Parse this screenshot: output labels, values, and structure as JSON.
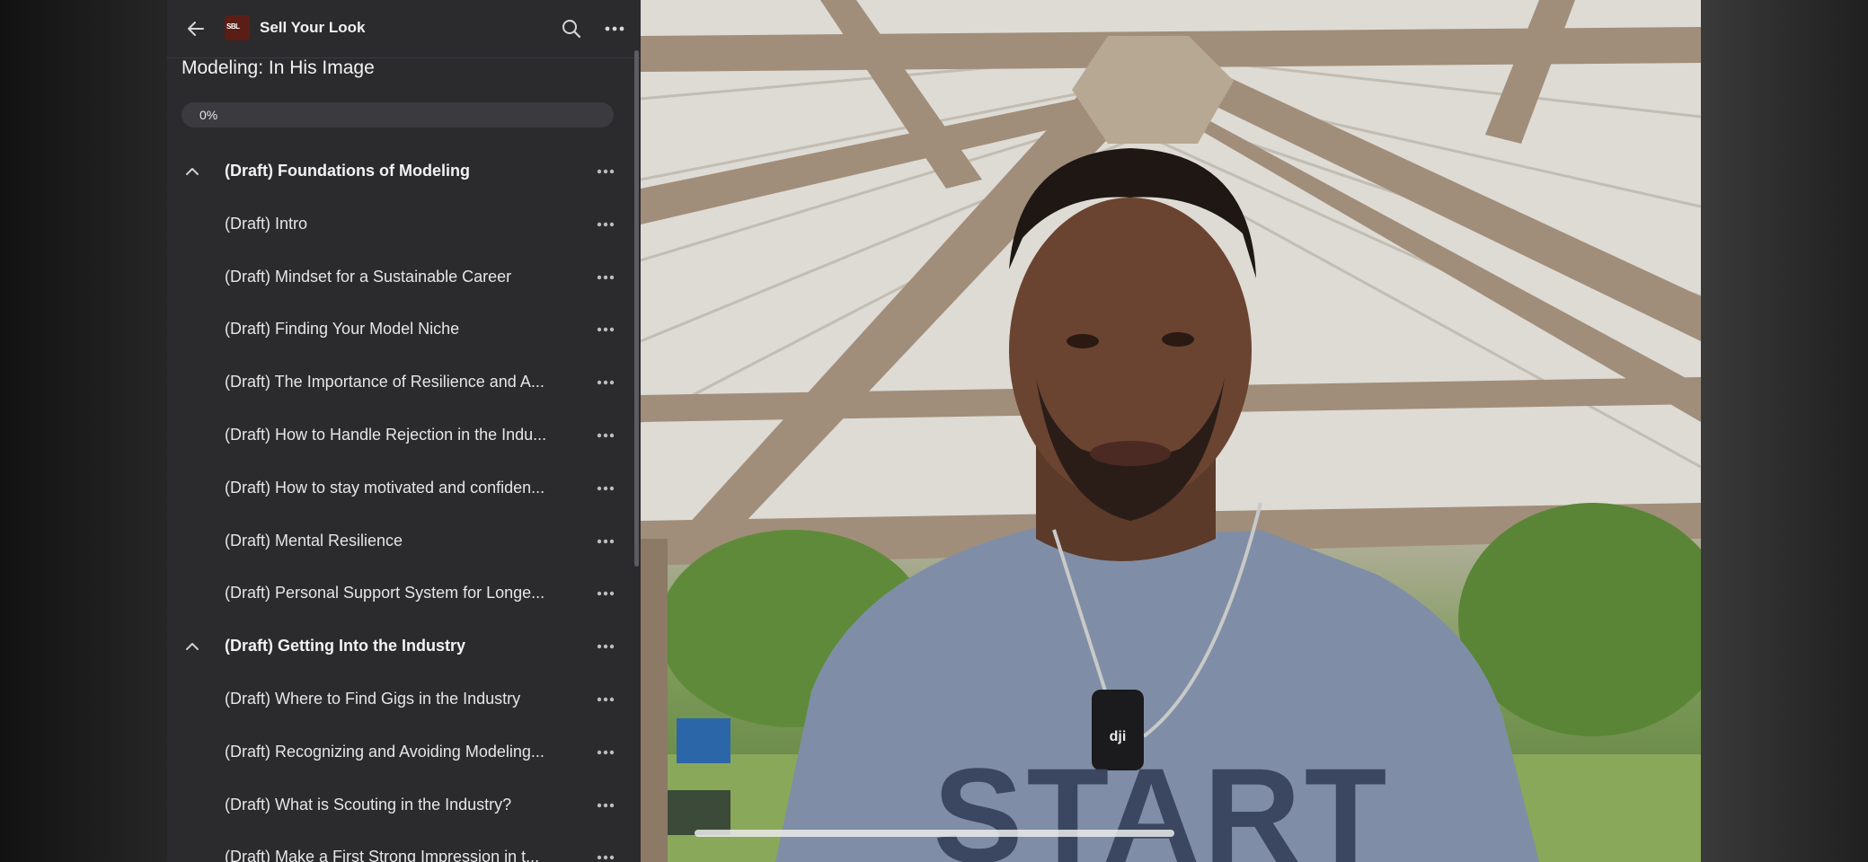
{
  "app": {
    "title": "Sell Your Look",
    "logo_text": "SBL",
    "course_title": "Modeling: In His Image",
    "progress_label": "0%",
    "progress_fraction": 0.0
  },
  "icons": {
    "back": "arrow-left-icon",
    "search": "search-icon",
    "more": "more-horizontal-icon",
    "collapse": "chevron-up-icon"
  },
  "lessons": [
    {
      "label": "(Draft) Foundations of Modeling",
      "type": "section"
    },
    {
      "label": "(Draft) Intro",
      "type": "lesson"
    },
    {
      "label": "(Draft) Mindset for a Sustainable Career",
      "type": "lesson"
    },
    {
      "label": "(Draft) Finding Your Model Niche",
      "type": "lesson"
    },
    {
      "label": "(Draft) The Importance of Resilience and A...",
      "type": "lesson"
    },
    {
      "label": "(Draft) How to Handle Rejection in the Indu...",
      "type": "lesson"
    },
    {
      "label": "(Draft) How to stay motivated and confiden...",
      "type": "lesson"
    },
    {
      "label": "(Draft) Mental Resilience",
      "type": "lesson"
    },
    {
      "label": "(Draft) Personal Support System for Longe...",
      "type": "lesson"
    },
    {
      "label": "(Draft) Getting Into the Industry",
      "type": "section"
    },
    {
      "label": "(Draft) Where to Find Gigs in the Industry",
      "type": "lesson"
    },
    {
      "label": "(Draft) Recognizing and Avoiding Modeling...",
      "type": "lesson"
    },
    {
      "label": "(Draft) What is Scouting in the Industry?",
      "type": "lesson"
    },
    {
      "label": "(Draft) Make a First Strong Impression in t...",
      "type": "lesson"
    }
  ],
  "video": {
    "shirt_text": "START",
    "mic_logo": "dji"
  }
}
